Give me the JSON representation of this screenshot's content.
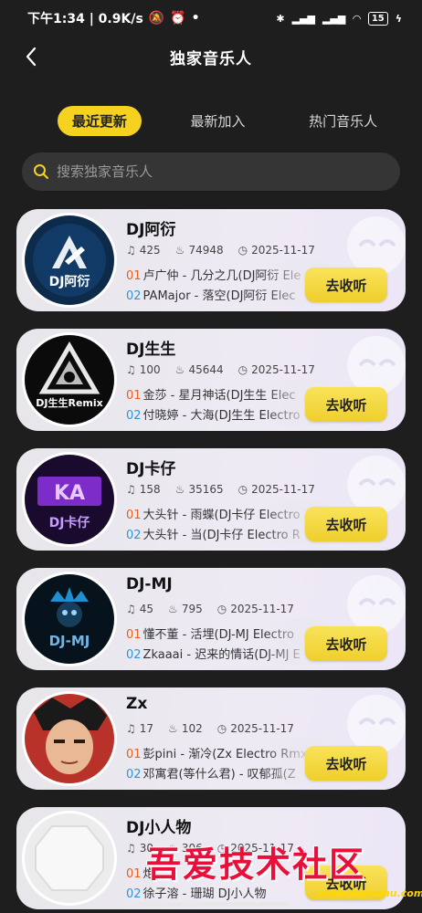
{
  "status_bar": {
    "time_speed": "下午1:34 | 0.9K/s",
    "battery": "15"
  },
  "header": {
    "title": "独家音乐人"
  },
  "tabs": [
    {
      "label": "最近更新",
      "active": true
    },
    {
      "label": "最新加入",
      "active": false
    },
    {
      "label": "热门音乐人",
      "active": false
    }
  ],
  "search": {
    "placeholder": "搜索独家音乐人"
  },
  "listen_label": "去收听",
  "artists": [
    {
      "name": "DJ阿衍",
      "songs_count": "425",
      "hot": "74948",
      "date": "2025-11-17",
      "song1_num": "01",
      "song1": "卢广仲 - 几分之几(DJ阿衍 Ele",
      "song2_num": "02",
      "song2": "PAMajor - 落空(DJ阿衍 Elec",
      "avatar_text": "DJ阿衍"
    },
    {
      "name": "DJ生生",
      "songs_count": "100",
      "hot": "45644",
      "date": "2025-11-17",
      "song1_num": "01",
      "song1": "金莎 - 星月神话(DJ生生 Elec",
      "song2_num": "02",
      "song2": "付晓婷 - 大海(DJ生生 Electro",
      "avatar_text": "DJ生生Remix"
    },
    {
      "name": "DJ卡仔",
      "songs_count": "158",
      "hot": "35165",
      "date": "2025-11-17",
      "song1_num": "01",
      "song1": "大头针 - 雨蝶(DJ卡仔 Electro",
      "song2_num": "02",
      "song2": "大头针 - 当(DJ卡仔 Electro R",
      "avatar_text": "DJ卡仔"
    },
    {
      "name": "DJ-MJ",
      "songs_count": "45",
      "hot": "795",
      "date": "2025-11-17",
      "song1_num": "01",
      "song1": "懂不董 - 活埋(DJ-MJ Electro",
      "song2_num": "02",
      "song2": "Zkaaai - 迟来的情话(DJ-MJ E",
      "avatar_text": "DJ-MJ"
    },
    {
      "name": "Zx",
      "songs_count": "17",
      "hot": "102",
      "date": "2025-11-17",
      "song1_num": "01",
      "song1": "彭pini - 渐冷(Zx Electro Rmx",
      "song2_num": "02",
      "song2": "邓寓君(等什么君) - 叹郁孤(Z",
      "avatar_text": ""
    },
    {
      "name": "DJ小人物",
      "songs_count": "30",
      "hot": "306",
      "date": "2025-11-17",
      "song1_num": "01",
      "song1": "炮",
      "song2_num": "02",
      "song2": "徐子溶 - 珊瑚 DJ小人物",
      "avatar_text": ""
    }
  ],
  "watermark": {
    "text": "吾爱技术社区",
    "url": "www.pojieshu.com"
  },
  "colors": {
    "accent_yellow": "#f5d21f",
    "num1_orange": "#e6611f",
    "num2_blue": "#2f96d8",
    "background": "#1e1e1e"
  }
}
